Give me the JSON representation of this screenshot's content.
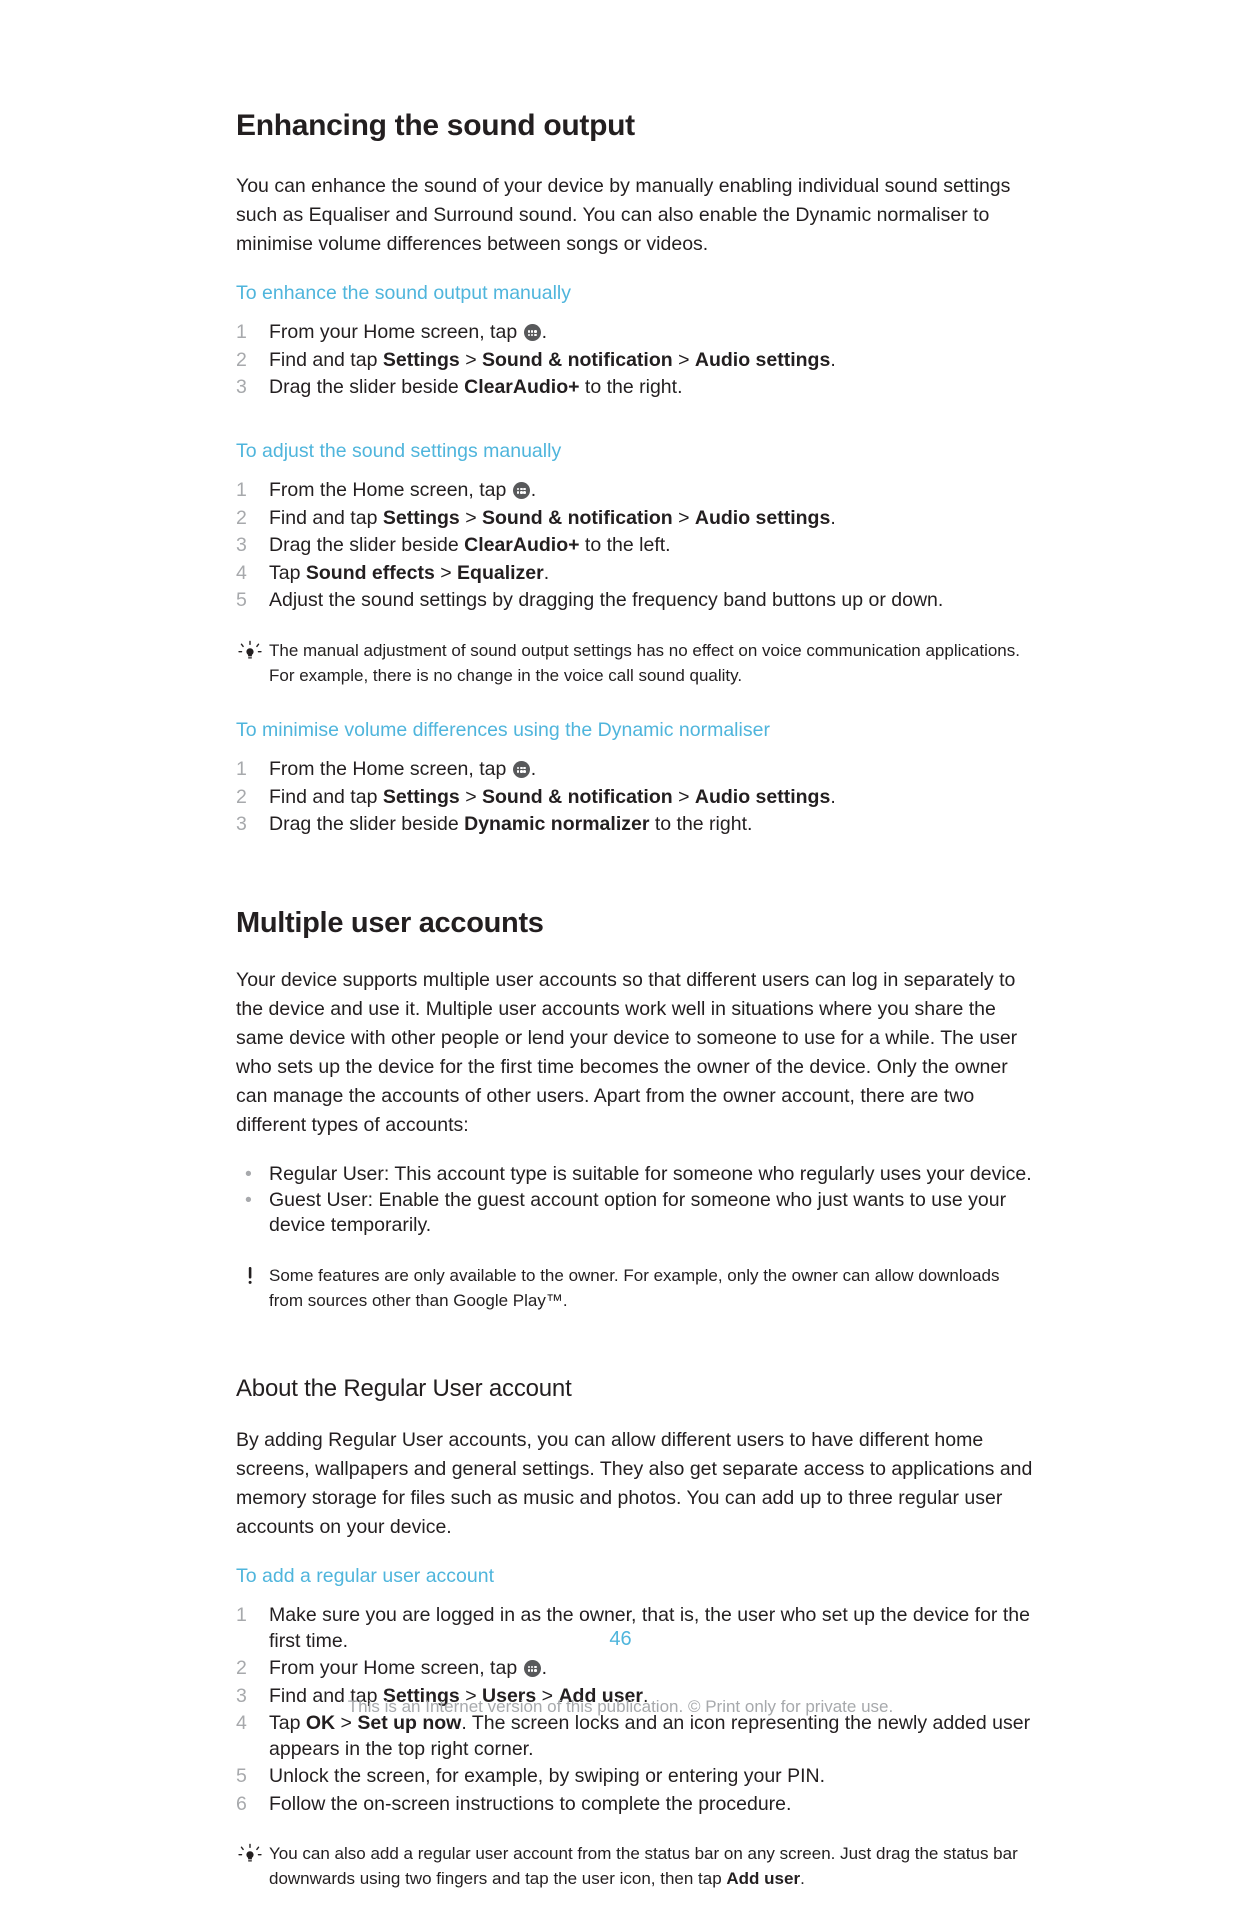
{
  "page": {
    "number": "46",
    "copyright": "This is an Internet version of this publication. © Print only for private use."
  },
  "sections": [
    {
      "id": "enhancing-sound-output",
      "title": "Enhancing the sound output",
      "intro": "You can enhance the sound of your device by manually enabling individual sound settings such as Equaliser and Surround sound. You can also enable the Dynamic normaliser to minimise volume differences between songs or videos.",
      "procedures": [
        {
          "title": "To enhance the sound output manually",
          "steps": [
            {
              "num": "1",
              "parts": [
                {
                  "t": "text",
                  "v": "From your Home screen, tap "
                },
                {
                  "t": "icon",
                  "v": "app-drawer-icon"
                },
                {
                  "t": "text",
                  "v": "."
                }
              ]
            },
            {
              "num": "2",
              "parts": [
                {
                  "t": "text",
                  "v": "Find and tap "
                },
                {
                  "t": "bold",
                  "v": "Settings"
                },
                {
                  "t": "text",
                  "v": " > "
                },
                {
                  "t": "bold",
                  "v": "Sound & notification"
                },
                {
                  "t": "text",
                  "v": " > "
                },
                {
                  "t": "bold",
                  "v": "Audio settings"
                },
                {
                  "t": "text",
                  "v": "."
                }
              ]
            },
            {
              "num": "3",
              "parts": [
                {
                  "t": "text",
                  "v": "Drag the slider beside "
                },
                {
                  "t": "bold",
                  "v": "ClearAudio+"
                },
                {
                  "t": "text",
                  "v": " to the right."
                }
              ]
            }
          ]
        },
        {
          "title": "To adjust the sound settings manually",
          "steps": [
            {
              "num": "1",
              "parts": [
                {
                  "t": "text",
                  "v": "From the Home screen, tap "
                },
                {
                  "t": "icon",
                  "v": "app-drawer-icon"
                },
                {
                  "t": "text",
                  "v": "."
                }
              ]
            },
            {
              "num": "2",
              "parts": [
                {
                  "t": "text",
                  "v": "Find and tap "
                },
                {
                  "t": "bold",
                  "v": "Settings"
                },
                {
                  "t": "text",
                  "v": " > "
                },
                {
                  "t": "bold",
                  "v": "Sound & notification"
                },
                {
                  "t": "text",
                  "v": " > "
                },
                {
                  "t": "bold",
                  "v": "Audio settings"
                },
                {
                  "t": "text",
                  "v": "."
                }
              ]
            },
            {
              "num": "3",
              "parts": [
                {
                  "t": "text",
                  "v": "Drag the slider beside "
                },
                {
                  "t": "bold",
                  "v": "ClearAudio+"
                },
                {
                  "t": "text",
                  "v": " to the left."
                }
              ]
            },
            {
              "num": "4",
              "parts": [
                {
                  "t": "text",
                  "v": "Tap "
                },
                {
                  "t": "bold",
                  "v": "Sound effects"
                },
                {
                  "t": "text",
                  "v": " > "
                },
                {
                  "t": "bold",
                  "v": "Equalizer"
                },
                {
                  "t": "text",
                  "v": "."
                }
              ]
            },
            {
              "num": "5",
              "parts": [
                {
                  "t": "text",
                  "v": "Adjust the sound settings by dragging the frequency band buttons up or down."
                }
              ]
            }
          ],
          "note": {
            "icon": "tip-lightbulb-icon",
            "text": "The manual adjustment of sound output settings has no effect on voice communication applications. For example, there is no change in the voice call sound quality."
          }
        },
        {
          "title": "To minimise volume differences using the Dynamic normaliser",
          "steps": [
            {
              "num": "1",
              "parts": [
                {
                  "t": "text",
                  "v": "From the Home screen, tap "
                },
                {
                  "t": "icon",
                  "v": "app-drawer-icon"
                },
                {
                  "t": "text",
                  "v": "."
                }
              ]
            },
            {
              "num": "2",
              "parts": [
                {
                  "t": "text",
                  "v": "Find and tap "
                },
                {
                  "t": "bold",
                  "v": "Settings"
                },
                {
                  "t": "text",
                  "v": " > "
                },
                {
                  "t": "bold",
                  "v": "Sound & notification"
                },
                {
                  "t": "text",
                  "v": " > "
                },
                {
                  "t": "bold",
                  "v": "Audio settings"
                },
                {
                  "t": "text",
                  "v": "."
                }
              ]
            },
            {
              "num": "3",
              "parts": [
                {
                  "t": "text",
                  "v": "Drag the slider beside "
                },
                {
                  "t": "bold",
                  "v": "Dynamic normalizer"
                },
                {
                  "t": "text",
                  "v": " to the right."
                }
              ]
            }
          ]
        }
      ]
    },
    {
      "id": "multiple-user-accounts",
      "title": "Multiple user accounts",
      "intro": "Your device supports multiple user accounts so that different users can log in separately to the device and use it. Multiple user accounts work well in situations where you share the same device with other people or lend your device to someone to use for a while. The user who sets up the device for the first time becomes the owner of the device. Only the owner can manage the accounts of other users. Apart from the owner account, there are two different types of accounts:",
      "bullets": [
        "Regular User: This account type is suitable for someone who regularly uses your device.",
        "Guest User: Enable the guest account option for someone who just wants to use your device temporarily."
      ],
      "note": {
        "icon": "warning-exclamation-icon",
        "text": "Some features are only available to the owner. For example, only the owner can allow downloads from sources other than Google Play™."
      },
      "subsection": {
        "title": "About the Regular User account",
        "intro": "By adding Regular User accounts, you can allow different users to have different home screens, wallpapers and general settings. They also get separate access to applications and memory storage for files such as music and photos. You can add up to three regular user accounts on your device.",
        "procedure": {
          "title": "To add a regular user account",
          "steps": [
            {
              "num": "1",
              "parts": [
                {
                  "t": "text",
                  "v": "Make sure you are logged in as the owner, that is, the user who set up the device for the first time."
                }
              ]
            },
            {
              "num": "2",
              "parts": [
                {
                  "t": "text",
                  "v": "From your Home screen, tap "
                },
                {
                  "t": "icon",
                  "v": "app-drawer-icon"
                },
                {
                  "t": "text",
                  "v": "."
                }
              ]
            },
            {
              "num": "3",
              "parts": [
                {
                  "t": "text",
                  "v": "Find and tap "
                },
                {
                  "t": "bold",
                  "v": "Settings"
                },
                {
                  "t": "text",
                  "v": " > "
                },
                {
                  "t": "bold",
                  "v": "Users"
                },
                {
                  "t": "text",
                  "v": " > "
                },
                {
                  "t": "bold",
                  "v": "Add user"
                },
                {
                  "t": "text",
                  "v": "."
                }
              ]
            },
            {
              "num": "4",
              "parts": [
                {
                  "t": "text",
                  "v": "Tap "
                },
                {
                  "t": "bold",
                  "v": "OK"
                },
                {
                  "t": "text",
                  "v": " > "
                },
                {
                  "t": "bold",
                  "v": "Set up now"
                },
                {
                  "t": "text",
                  "v": ". The screen locks and an icon representing the newly added user appears in the top right corner."
                }
              ]
            },
            {
              "num": "5",
              "parts": [
                {
                  "t": "text",
                  "v": "Unlock the screen, for example, by swiping or entering your PIN."
                }
              ]
            },
            {
              "num": "6",
              "parts": [
                {
                  "t": "text",
                  "v": "Follow the on-screen instructions to complete the procedure."
                }
              ]
            }
          ],
          "note": {
            "icon": "tip-lightbulb-icon",
            "text_parts": [
              {
                "t": "text",
                "v": "You can also add a regular user account from the status bar on any screen. Just drag the status bar downwards using two fingers and tap the user icon, then tap "
              },
              {
                "t": "bold",
                "v": "Add user"
              },
              {
                "t": "text",
                "v": "."
              }
            ]
          }
        }
      }
    }
  ],
  "colors": {
    "accent": "#4fb5dc",
    "body_text": "#231f20",
    "muted": "#a7a9ac",
    "icon_bg": "#58595b"
  }
}
